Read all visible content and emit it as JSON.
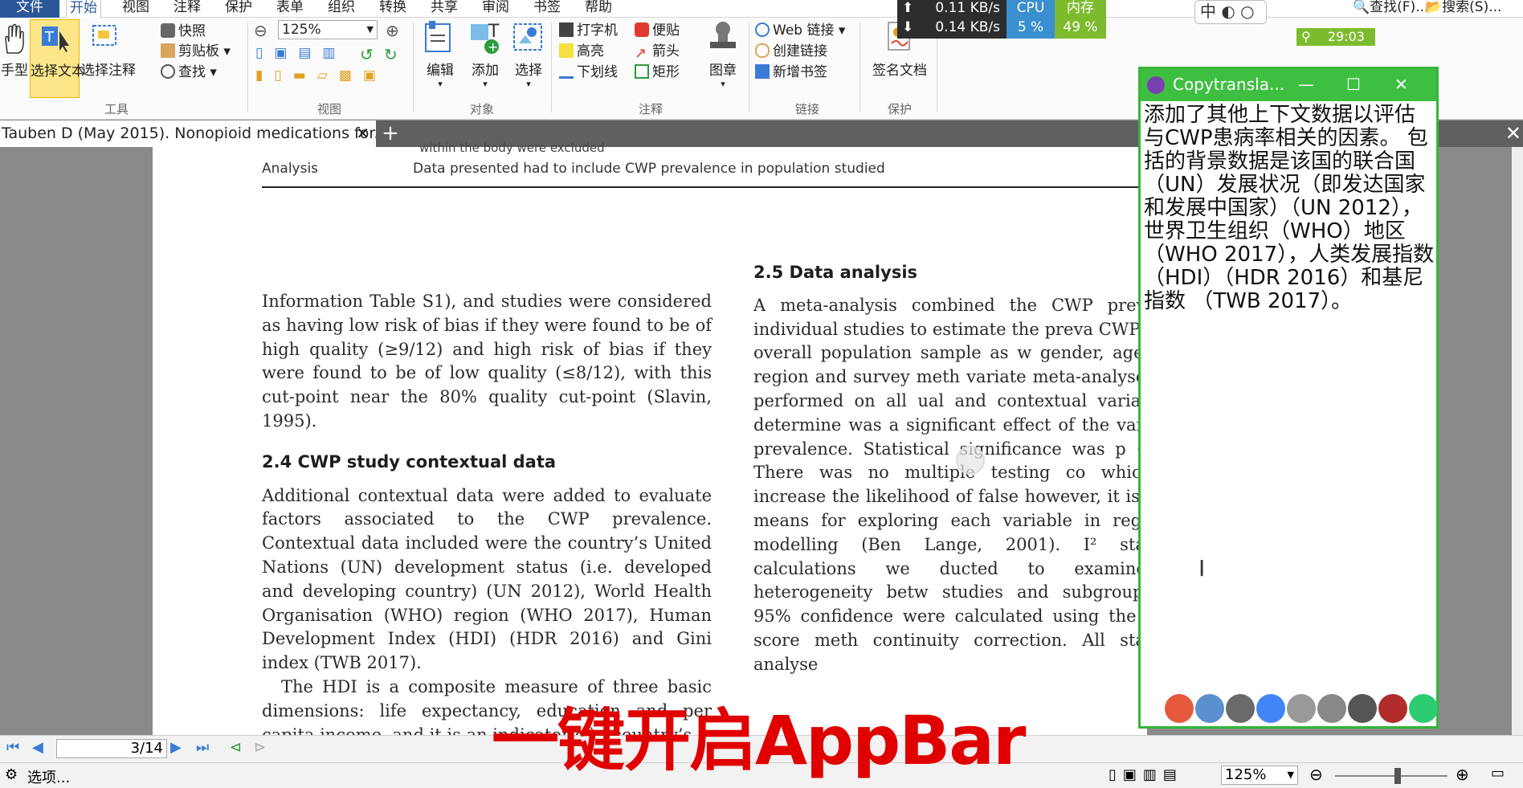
{
  "menu": [
    "文件",
    "开始",
    "视图",
    "注释",
    "保护",
    "表单",
    "组织",
    "转换",
    "共享",
    "审阅",
    "书签",
    "帮助"
  ],
  "menu_right": {
    "find": "查找(F)...",
    "search": "搜索(S)..."
  },
  "ribbon": {
    "groups": [
      "工具",
      "视图",
      "对象",
      "注释",
      "链接",
      "保护"
    ],
    "tools": {
      "hand": "手型",
      "select_text": "选择文本",
      "select_annotation": "选择注释",
      "snapshot": "快照",
      "clipboard": "剪贴板",
      "find": "查找"
    },
    "view": {
      "zoom": "125%"
    },
    "object": {
      "edit": "编辑",
      "add": "添加",
      "select": "选择"
    },
    "annotate": {
      "typewriter": "打字机",
      "note": "便贴",
      "highlight": "高亮",
      "arrow": "箭头",
      "underline": "下划线",
      "rectangle": "矩形",
      "stamp": "图章"
    },
    "links": {
      "web_link": "Web 链接",
      "create_link": "创建链接",
      "add_bookmark": "新增书签"
    },
    "protect": {
      "sign": "签名文档"
    }
  },
  "netmon": {
    "upload": "0.11 KB/s",
    "download": "0.14 KB/s",
    "cpu_label": "CPU",
    "cpu": "5 %",
    "mem_label": "内存",
    "mem": "49 %"
  },
  "ime": {
    "mode": "中"
  },
  "timer": "29:03",
  "tabs": [
    {
      "title": "Tauben D (May 2015). Nonopioid medications for.."
    }
  ],
  "page": {
    "clipped_line": "within the body were excluded",
    "table_label": "Analysis",
    "table_value": "Data presented had to include CWP prevalence in population studied",
    "left": {
      "para1": "Information Table S1), and studies were considered as having low risk of bias if they were found to be of high quality (≥9/12) and high risk of bias if they were found to be of low quality (≤8/12), with this cut-point near the 80% quality cut-point (Slavin, 1995).",
      "heading": "2.4 CWP study contextual data",
      "para2": "Additional contextual data were added to evaluate factors associated to the CWP prevalence. Contextual data included were the country’s United Nations (UN) development status (i.e. developed and developing country) (UN 2012), World Health Organisation (WHO) region (WHO 2017), Human Development Index (HDI) (HDR 2016) and Gini index (TWB 2017).",
      "para3": "The HDI is a composite measure of three basic dimensions: life expectancy, education and per capita income, and it is an indicator of a country’s"
    },
    "right": {
      "heading": "2.5 Data analysis",
      "para1": "A meta-analysis combined the CWP preval the individual studies to estimate the preva CWP for the overall population sample as w gender, age, WHO region and survey meth variate meta-analyses were performed on all ual and contextual variables to determine was a significant effect of the variable o prevalence. Statistical significance was p < 0.05. There was no multiple testing co which may increase the likelihood of false however, it is a valid means for exploring each variable in regression modelling (Ben Lange, 2001). I² statistical calculations we ducted to examine the heterogeneity betw studies and subgroups. The 95% confidence were calculated using the Wilson score meth continuity correction. All statistical analyse"
    }
  },
  "popup": {
    "title": "Copytransla...",
    "translation": "添加了其他上下文数据以评估与CWP患病率相关的因素。 包括的背景数据是该国的联合国（UN）发展状况（即发达国家和发展中国家）（UN 2012），世界卫生组织（WHO）地区（WHO 2017），人类发展指数（HDI）（HDR 2016）和基尼指数 （TWB 2017）。"
  },
  "nav": {
    "page": "3",
    "total": "14"
  },
  "status": {
    "options": "选项...",
    "zoom": "125%"
  },
  "caption": "一键开启AppBar"
}
